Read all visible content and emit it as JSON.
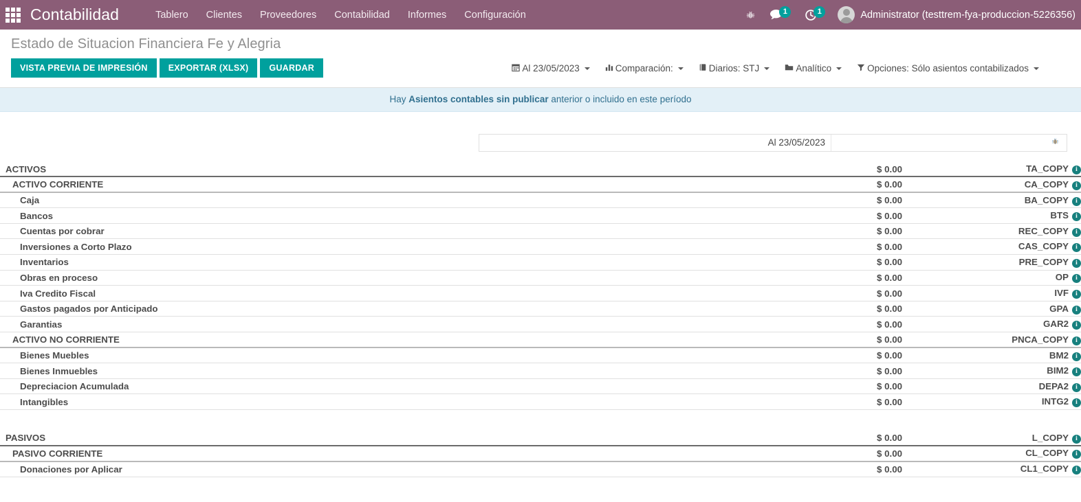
{
  "navbar": {
    "apps_icon": "apps-grid-icon",
    "brand": "Contabilidad",
    "menu": [
      {
        "label": "Tablero"
      },
      {
        "label": "Clientes"
      },
      {
        "label": "Proveedores"
      },
      {
        "label": "Contabilidad"
      },
      {
        "label": "Informes"
      },
      {
        "label": "Configuración"
      }
    ],
    "bug_icon": "bug-icon",
    "messages": {
      "icon": "chat-bubble-icon",
      "count": "1"
    },
    "activities": {
      "icon": "clock-icon",
      "count": "1"
    },
    "user": "Administrator (testtrem-fya-produccion-5226356)",
    "brand_color": "#8b5d77",
    "accent_color": "#00a09d"
  },
  "control_panel": {
    "title": "Estado de Situacion Financiera Fe y Alegria",
    "buttons": [
      {
        "label": "VISTA PREVIA DE IMPRESIÓN",
        "name": "print-preview-button"
      },
      {
        "label": "EXPORTAR (XLSX)",
        "name": "export-xlsx-button"
      },
      {
        "label": "GUARDAR",
        "name": "save-button"
      }
    ],
    "filters": [
      {
        "icon": "calendar-icon",
        "label": "Al 23/05/2023",
        "name": "date-filter"
      },
      {
        "icon": "bar-chart-icon",
        "label": "Comparación:",
        "name": "comparison-filter"
      },
      {
        "icon": "book-icon",
        "label": "Diarios: STJ",
        "name": "journals-filter"
      },
      {
        "icon": "folder-icon",
        "label": "Analítico",
        "name": "analytic-filter"
      },
      {
        "icon": "funnel-icon",
        "label": "Opciones: Sólo asientos contabilizados",
        "name": "options-filter"
      }
    ]
  },
  "alert": {
    "prefix": "Hay ",
    "strong": "Asientos contables sin publicar",
    "suffix": " anterior o incluido en este período"
  },
  "report": {
    "header_date": "Al 23/05/2023",
    "header_bug_icon": "bug-icon",
    "rows": [
      {
        "name": "ACTIVOS",
        "amount": "$ 0.00",
        "code": "TA_COPY",
        "level": 0,
        "sep": "double"
      },
      {
        "name": "ACTIVO CORRIENTE",
        "amount": "$ 0.00",
        "code": "CA_COPY",
        "level": 1,
        "sep": "medium"
      },
      {
        "name": "Caja",
        "amount": "$ 0.00",
        "code": "BA_COPY",
        "level": 2,
        "sep": "thin"
      },
      {
        "name": "Bancos",
        "amount": "$ 0.00",
        "code": "BTS",
        "level": 2,
        "sep": "thin"
      },
      {
        "name": "Cuentas por cobrar",
        "amount": "$ 0.00",
        "code": "REC_COPY",
        "level": 2,
        "sep": "thin"
      },
      {
        "name": "Inversiones a Corto Plazo",
        "amount": "$ 0.00",
        "code": "CAS_COPY",
        "level": 2,
        "sep": "thin"
      },
      {
        "name": "Inventarios",
        "amount": "$ 0.00",
        "code": "PRE_COPY",
        "level": 2,
        "sep": "thin"
      },
      {
        "name": "Obras en proceso",
        "amount": "$ 0.00",
        "code": "OP",
        "level": 2,
        "sep": "thin"
      },
      {
        "name": "Iva Credito Fiscal",
        "amount": "$ 0.00",
        "code": "IVF",
        "level": 2,
        "sep": "thin"
      },
      {
        "name": "Gastos pagados por Anticipado",
        "amount": "$ 0.00",
        "code": "GPA",
        "level": 2,
        "sep": "thin"
      },
      {
        "name": "Garantias",
        "amount": "$ 0.00",
        "code": "GAR2",
        "level": 2,
        "sep": "thin"
      },
      {
        "name": "ACTIVO NO CORRIENTE",
        "amount": "$ 0.00",
        "code": "PNCA_COPY",
        "level": 1,
        "sep": "medium"
      },
      {
        "name": "Bienes Muebles",
        "amount": "$ 0.00",
        "code": "BM2",
        "level": 2,
        "sep": "thin"
      },
      {
        "name": "Bienes Inmuebles",
        "amount": "$ 0.00",
        "code": "BIM2",
        "level": 2,
        "sep": "thin"
      },
      {
        "name": "Depreciacion Acumulada",
        "amount": "$ 0.00",
        "code": "DEPA2",
        "level": 2,
        "sep": "thin"
      },
      {
        "name": "Intangibles",
        "amount": "$ 0.00",
        "code": "INTG2",
        "level": 2,
        "sep": "thin"
      },
      {
        "name": "",
        "amount": "",
        "code": "",
        "level": 0,
        "sep": "spacer"
      },
      {
        "name": "PASIVOS",
        "amount": "$ 0.00",
        "code": "L_COPY",
        "level": 0,
        "sep": "double"
      },
      {
        "name": "PASIVO CORRIENTE",
        "amount": "$ 0.00",
        "code": "CL_COPY",
        "level": 1,
        "sep": "medium"
      },
      {
        "name": "Donaciones por Aplicar",
        "amount": "$ 0.00",
        "code": "CL1_COPY",
        "level": 2,
        "sep": "thin"
      }
    ]
  }
}
